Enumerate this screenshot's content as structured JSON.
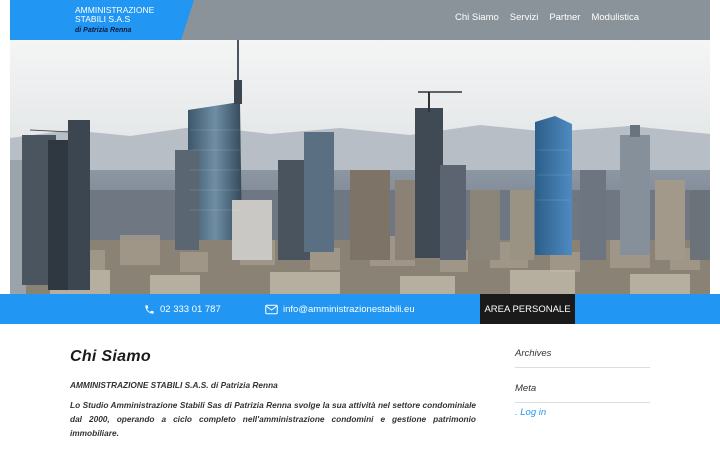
{
  "header": {
    "logo_title": "AMMINISTRAZIONE STABILI S.A.S",
    "logo_subtitle": "di Patrizia Renna",
    "nav": [
      "Chi Siamo",
      "Servizi",
      "Partner",
      "Modulistica"
    ]
  },
  "contact": {
    "phone": "02 333 01 787",
    "email": "info@amministrazionestabili.eu",
    "area_button": "AREA PERSONALE"
  },
  "main": {
    "title": "Chi Siamo",
    "company": "AMMINISTRAZIONE STABILI S.A.S. di Patrizia Renna",
    "description": "Lo Studio Amministrazione Stabili Sas di Patrizia Renna svolge la sua attività nel settore condominiale dal 2000, operando a ciclo completo nell'amministrazione condomini e gestione patrimonio immobiliare."
  },
  "sidebar": {
    "archives_title": "Archives",
    "meta_title": "Meta",
    "meta_link": ". Log in"
  },
  "colors": {
    "accent": "#2196f3",
    "header_bg": "#8a9399",
    "dark_button": "#1a1a1a"
  },
  "icons": {
    "phone": "phone-icon",
    "mail": "mail-icon"
  }
}
